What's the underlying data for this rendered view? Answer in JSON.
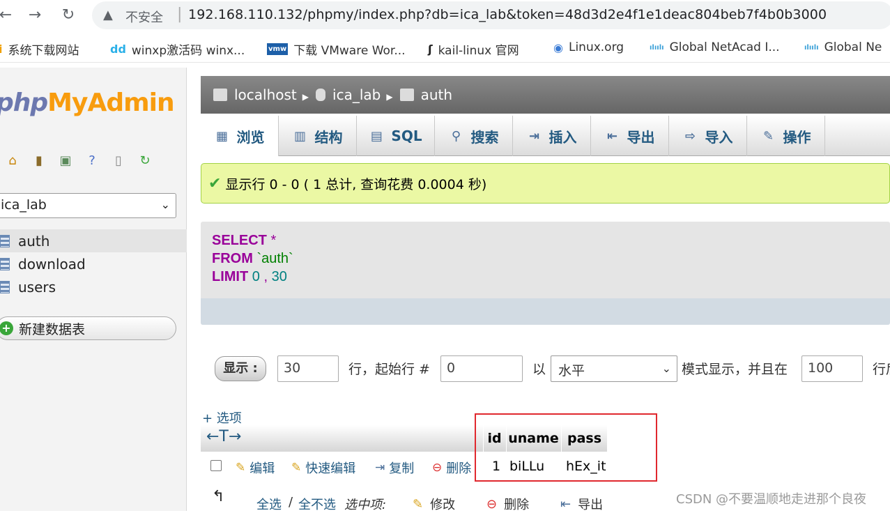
{
  "browser": {
    "insecure_label": "不安全",
    "url": "192.168.110.132/phpmy/index.php?db=ica_lab&token=48d3d2e4f1e1deac804beb7f4b0b3000"
  },
  "bookmarks": [
    {
      "label": "系统下载网站"
    },
    {
      "label": "winxp激活码 winx..."
    },
    {
      "label": "下载 VMware Wor..."
    },
    {
      "label": "kail-linux 官网"
    },
    {
      "label": "Linux.org"
    },
    {
      "label": "Global NetAcad I..."
    },
    {
      "label": "Global Ne"
    }
  ],
  "sidebar": {
    "logo_php": "php",
    "logo_my": "My",
    "logo_admin": "Admin",
    "db_selected": "ica_lab",
    "tables": [
      "auth",
      "download",
      "users"
    ],
    "new_table": "新建数据表"
  },
  "breadcrumb": {
    "server": "localhost",
    "database": "ica_lab",
    "table": "auth"
  },
  "tabs": [
    "浏览",
    "结构",
    "SQL",
    "搜索",
    "插入",
    "导出",
    "导入",
    "操作"
  ],
  "message": "显示行 0 - 0 ( 1 总计, 查询花费 0.0004 秒)",
  "sql": {
    "select_kw": "SELECT",
    "star": "*",
    "from_kw": "FROM",
    "table": "`auth`",
    "limit_kw": "LIMIT",
    "offset": "0",
    "comma": ",",
    "count": "30"
  },
  "nav": {
    "show_button": "显示 :",
    "rows_value": "30",
    "label_rows_start": "行，起始行 #",
    "start_value": "0",
    "label_with": "以",
    "mode_value": "水平",
    "label_mode": "模式显示，并且在",
    "repeat_value": "100",
    "label_tail": "行后"
  },
  "options_link": "+ 选项",
  "results": {
    "columns": [
      "id",
      "uname",
      "pass"
    ],
    "row": {
      "edit": "编辑",
      "quick_edit": "快速编辑",
      "copy": "复制",
      "delete": "删除",
      "id": "1",
      "uname": "biLLu",
      "pass": "hEx_it"
    }
  },
  "bottom": {
    "select_all": "全选",
    "slash": "/",
    "deselect_all": "全不选",
    "selected_label": "选中项:",
    "modify": "修改",
    "delete": "删除",
    "export": "导出"
  },
  "watermark": "CSDN @不要温顺地走进那个良夜"
}
